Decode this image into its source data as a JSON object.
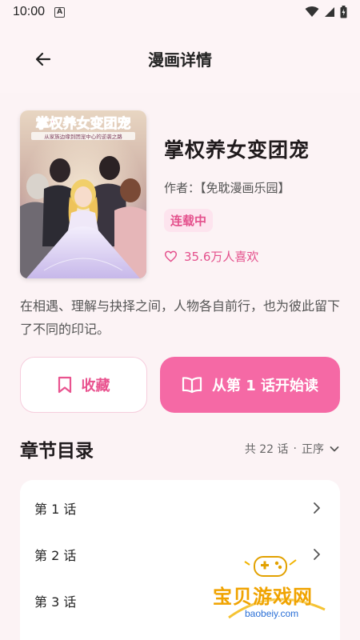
{
  "statusbar": {
    "time": "10:00",
    "notif_glyph": "A"
  },
  "header": {
    "title": "漫画详情"
  },
  "book": {
    "title": "掌权养女变团宠",
    "author": "作者：【免耽漫画乐园】",
    "status": "连载中",
    "likes": "35.6万人喜欢",
    "cover_title": "掌权养女变团宠",
    "cover_subtitle": "从家族边缘到团宠中心的逆袭之路",
    "description": "在相遇、理解与抉择之间，人物各自前行，也为彼此留下了不同的印记。"
  },
  "actions": {
    "favorite_label": "收藏",
    "read_label": "从第 1 话开始读"
  },
  "chapters": {
    "title": "章节目录",
    "count": "共 22 话",
    "separator": "·",
    "sort_label": "正序",
    "items": [
      {
        "label": "第 1 话"
      },
      {
        "label": "第 2 话"
      },
      {
        "label": "第 3 话"
      }
    ]
  },
  "watermark": {
    "text": "宝贝游戏网",
    "url": "baobeiy.com"
  },
  "colors": {
    "accent": "#f569a5",
    "accent_text": "#e4508c",
    "badge_bg": "#fde4ee",
    "background": "#fcf3f5"
  }
}
